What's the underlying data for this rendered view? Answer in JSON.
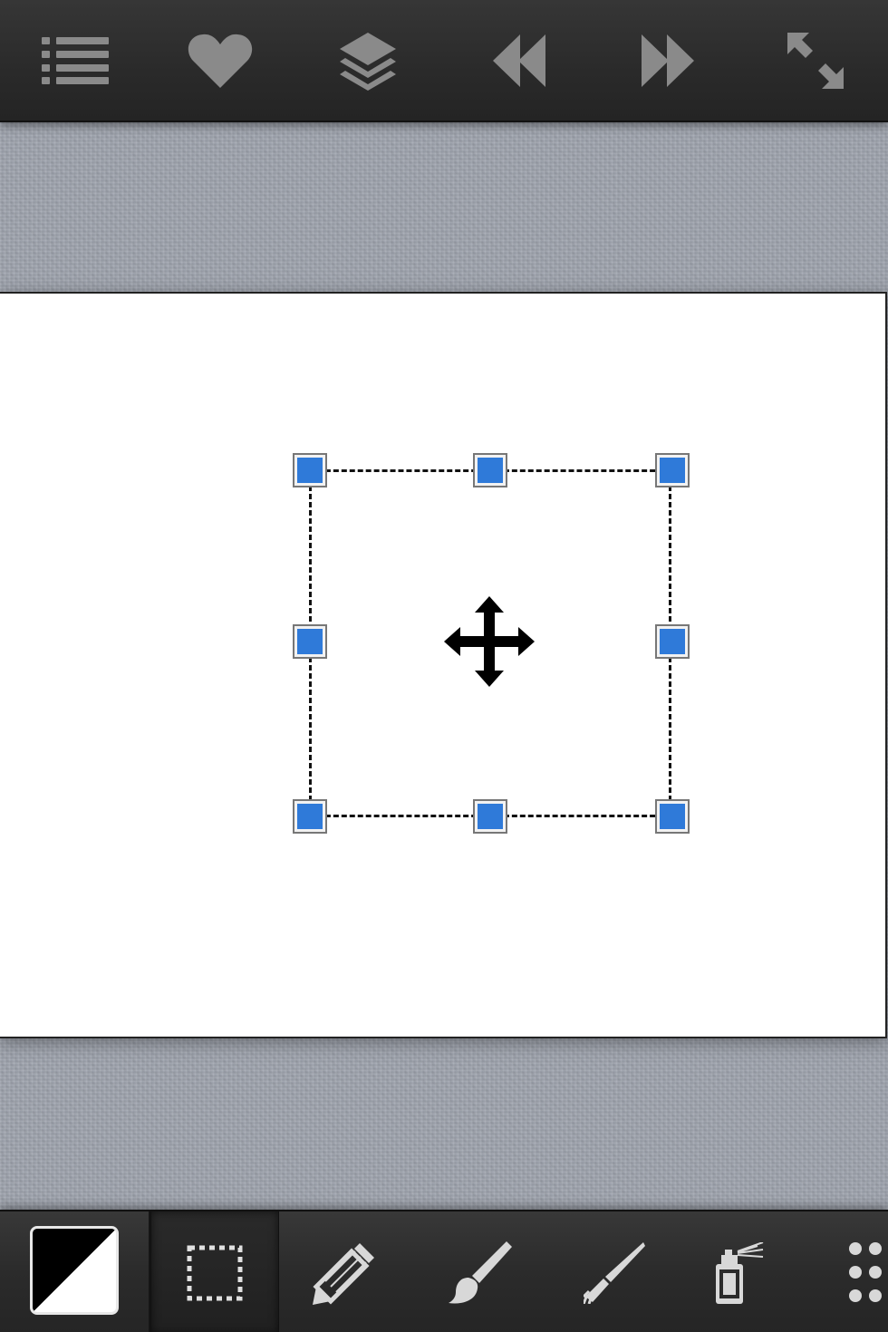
{
  "top_toolbar": {
    "icons": [
      "list-icon",
      "heart-icon",
      "layers-icon",
      "rewind-icon",
      "fast-forward-icon",
      "fullscreen-icon"
    ]
  },
  "canvas": {
    "selection_tool_active": true,
    "move_icon": "move-arrows-icon"
  },
  "bottom_toolbar": {
    "colors": {
      "primary": "#000000",
      "secondary": "#ffffff"
    },
    "tools": [
      "color-swatch",
      "rect-select-icon",
      "pencil-icon",
      "brush-icon",
      "feather-brush-icon",
      "spray-can-icon",
      "more-dots-icon"
    ],
    "selected_tool": "rect-select-icon"
  },
  "accent_color": "#2f7ad9"
}
